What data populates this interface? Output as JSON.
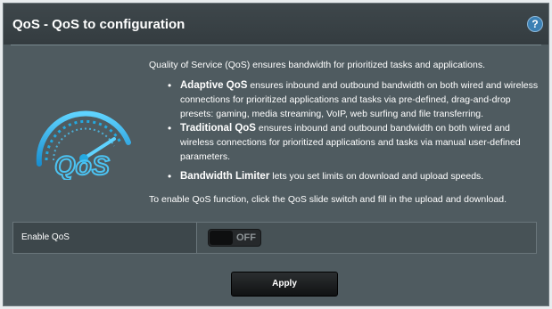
{
  "header": {
    "title": "QoS - QoS to configuration",
    "help_icon": "question-mark-icon",
    "help_glyph": "?"
  },
  "intro": "Quality of Service (QoS) ensures bandwidth for prioritized tasks and applications.",
  "bullets": [
    {
      "term": "Adaptive QoS",
      "text": " ensures inbound and outbound bandwidth on both wired and wireless connections for prioritized applications and tasks via pre-defined, drag-and-drop presets: gaming, media streaming, VoIP, web surfing and file transferring."
    },
    {
      "term": "Traditional QoS",
      "text": " ensures inbound and outbound bandwidth on both wired and wireless connections for prioritized applications and tasks via manual user-defined parameters."
    },
    {
      "term": "Bandwidth Limiter",
      "text": " lets you set limits on download and upload speeds."
    }
  ],
  "enable_note": "To enable QoS function, click the QoS slide switch and fill in the upload and download.",
  "logo": {
    "icon": "qos-speedometer-icon",
    "text": "QoS"
  },
  "enable_qos": {
    "label": "Enable QoS",
    "state_label": "OFF",
    "enabled": false
  },
  "apply_label": "Apply",
  "colors": {
    "panel": "#4f5b60",
    "header": "#3a4347",
    "accent": "#24a9e0",
    "button": "#1a1c1d"
  }
}
